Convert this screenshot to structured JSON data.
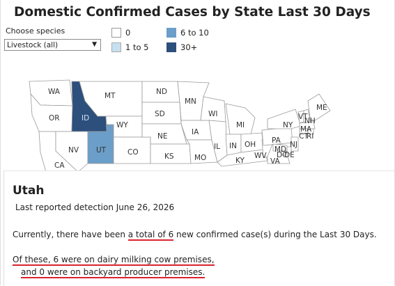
{
  "title": "Domestic Confirmed Cases by State Last 30 Days",
  "filter": {
    "label": "Choose species",
    "selected": "Livestock (all)"
  },
  "legend": [
    {
      "label": "0",
      "color": "#ffffff"
    },
    {
      "label": "1 to 5",
      "color": "#c7e0f0"
    },
    {
      "label": "6 to 10",
      "color": "#6b9ec8"
    },
    {
      "label": "30+",
      "color": "#2c4f7c"
    }
  ],
  "map": {
    "states": [
      {
        "abbr": "WA",
        "fill": "#ffffff"
      },
      {
        "abbr": "OR",
        "fill": "#ffffff"
      },
      {
        "abbr": "CA",
        "fill": "#ffffff"
      },
      {
        "abbr": "ID",
        "fill": "#2c4f7c"
      },
      {
        "abbr": "NV",
        "fill": "#ffffff"
      },
      {
        "abbr": "UT",
        "fill": "#6b9ec8"
      },
      {
        "abbr": "MT",
        "fill": "#ffffff"
      },
      {
        "abbr": "WY",
        "fill": "#ffffff"
      },
      {
        "abbr": "CO",
        "fill": "#ffffff"
      },
      {
        "abbr": "ND",
        "fill": "#ffffff"
      },
      {
        "abbr": "SD",
        "fill": "#ffffff"
      },
      {
        "abbr": "NE",
        "fill": "#ffffff"
      },
      {
        "abbr": "KS",
        "fill": "#ffffff"
      },
      {
        "abbr": "MN",
        "fill": "#ffffff"
      },
      {
        "abbr": "IA",
        "fill": "#ffffff"
      },
      {
        "abbr": "MO",
        "fill": "#ffffff"
      },
      {
        "abbr": "WI",
        "fill": "#ffffff"
      },
      {
        "abbr": "IL",
        "fill": "#ffffff"
      },
      {
        "abbr": "MI",
        "fill": "#ffffff"
      },
      {
        "abbr": "IN",
        "fill": "#ffffff"
      },
      {
        "abbr": "OH",
        "fill": "#ffffff"
      },
      {
        "abbr": "KY",
        "fill": "#ffffff"
      },
      {
        "abbr": "WV",
        "fill": "#ffffff"
      },
      {
        "abbr": "VA",
        "fill": "#ffffff"
      },
      {
        "abbr": "PA",
        "fill": "#ffffff"
      },
      {
        "abbr": "NY",
        "fill": "#ffffff"
      },
      {
        "abbr": "VT",
        "fill": "#ffffff"
      },
      {
        "abbr": "NH",
        "fill": "#ffffff"
      },
      {
        "abbr": "ME",
        "fill": "#ffffff"
      },
      {
        "abbr": "MA",
        "fill": "#ffffff"
      },
      {
        "abbr": "CT",
        "fill": "#ffffff"
      },
      {
        "abbr": "RI",
        "fill": "#ffffff"
      },
      {
        "abbr": "NJ",
        "fill": "#ffffff"
      },
      {
        "abbr": "MD",
        "fill": "#ffffff"
      },
      {
        "abbr": "DE",
        "fill": "#ffffff"
      },
      {
        "abbr": "DC",
        "fill": "#ffffff"
      }
    ]
  },
  "detail": {
    "state": "Utah",
    "last_detection": "Last reported detection June 26, 2026",
    "summary_pre": "Currently, there have been ",
    "summary_highlight": "a total of 6",
    "summary_post": " new confirmed case(s) during the Last 30 Days.",
    "dairy_line": "Of these, 6 were on dairy milking cow premises,",
    "backyard_line": "and 0 were on backyard producer premises."
  }
}
